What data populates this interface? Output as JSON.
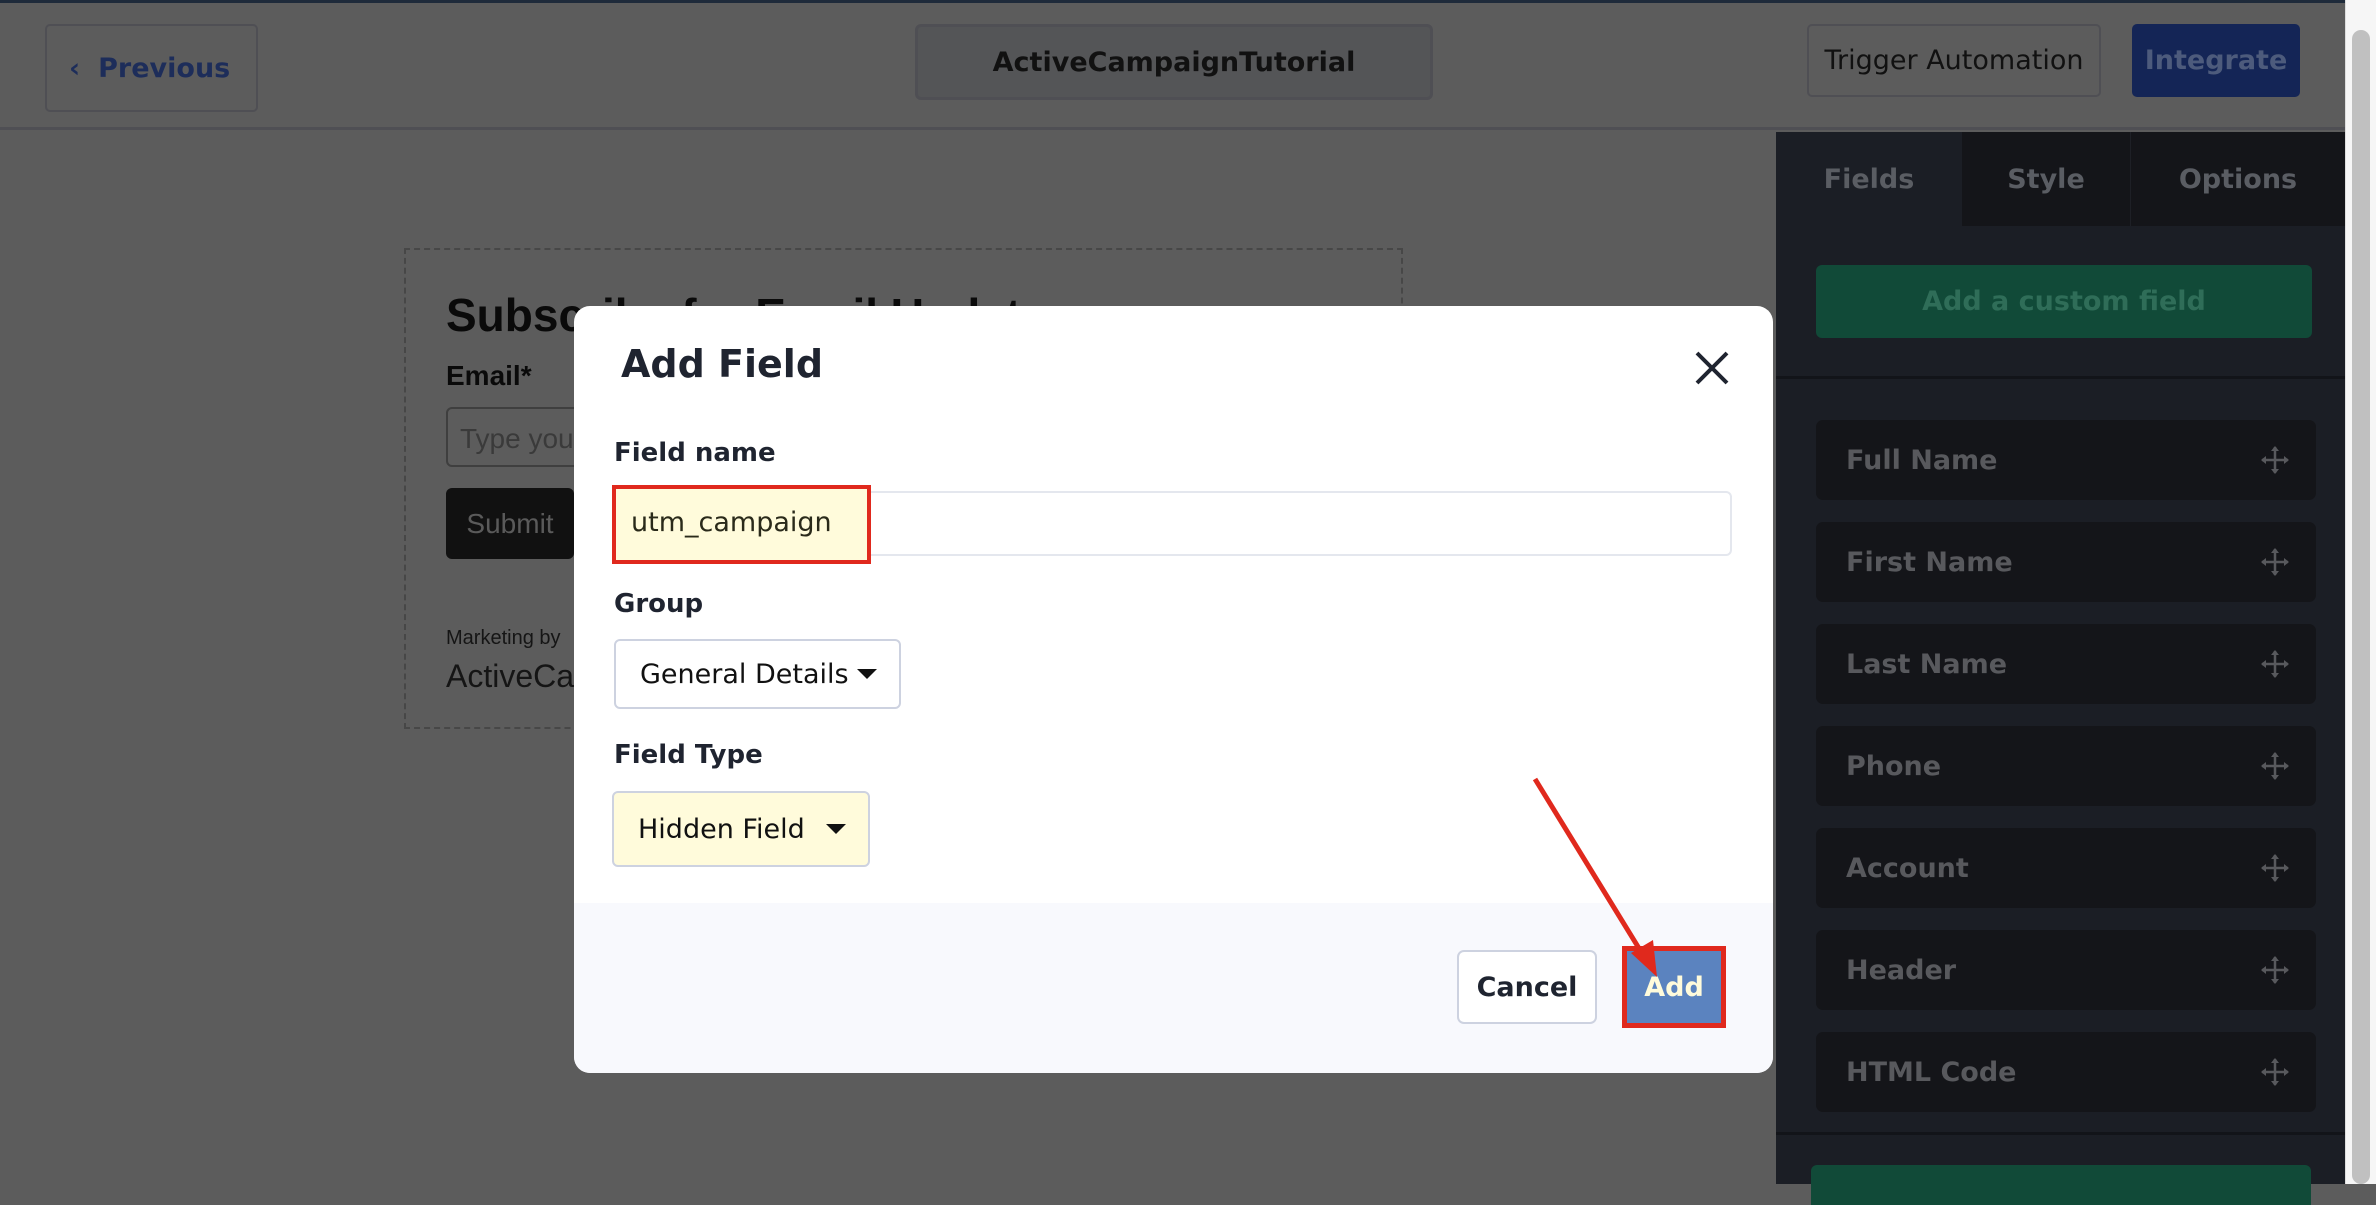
{
  "header": {
    "previous_label": "Previous",
    "form_name": "ActiveCampaignTutorial",
    "trigger_label": "Trigger Automation",
    "integrate_label": "Integrate"
  },
  "sidebar": {
    "tabs": [
      {
        "label": "Fields"
      },
      {
        "label": "Style"
      },
      {
        "label": "Options"
      }
    ],
    "add_custom_label": "Add a custom field",
    "items": [
      {
        "label": "Full Name"
      },
      {
        "label": "First Name"
      },
      {
        "label": "Last Name"
      },
      {
        "label": "Phone"
      },
      {
        "label": "Account"
      },
      {
        "label": "Header"
      },
      {
        "label": "HTML Code"
      }
    ]
  },
  "preview": {
    "heading": "Subscribe for Email Updates",
    "email_label": "Email*",
    "email_placeholder": "Type your email",
    "submit_label": "Submit",
    "marketing_by": "Marketing by",
    "brand": "ActiveCampaign"
  },
  "modal": {
    "title": "Add Field",
    "field_name_label": "Field name",
    "field_name_value": "utm_campaign",
    "group_label": "Group",
    "group_value": "General Details",
    "field_type_label": "Field Type",
    "field_type_value": "Hidden Field",
    "cancel_label": "Cancel",
    "add_label": "Add"
  },
  "colors": {
    "annotation_red": "#e0291d",
    "highlight": "#fffbdb",
    "add_button": "#5b83bf"
  }
}
